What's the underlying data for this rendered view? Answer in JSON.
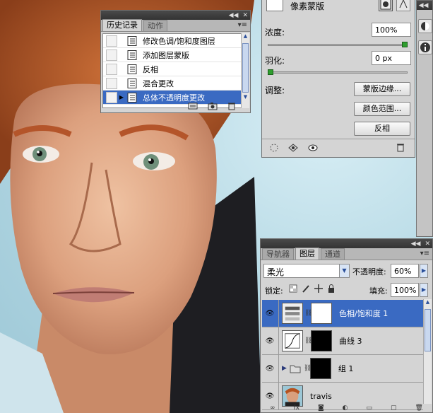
{
  "history": {
    "tabs": [
      "历史记录",
      "动作"
    ],
    "items": [
      {
        "label": "修改色调/饱和度图层",
        "selected": false
      },
      {
        "label": "添加图层蒙版",
        "selected": false
      },
      {
        "label": "反相",
        "selected": false
      },
      {
        "label": "混合更改",
        "selected": false
      },
      {
        "label": "总体不透明度更改",
        "selected": true
      }
    ]
  },
  "masks": {
    "header_label": "像素蒙版",
    "density_label": "浓度:",
    "density_value": "100%",
    "density_level": 1.0,
    "feather_label": "羽化:",
    "feather_value": "0 px",
    "feather_level": 0.0,
    "adjust_label": "调整:",
    "buttons": {
      "mask_edge": "蒙版边缘...",
      "color_range": "颜色范围...",
      "invert": "反相"
    }
  },
  "layers": {
    "tabs": [
      "导航器",
      "图层",
      "通道"
    ],
    "blend_mode": "柔光",
    "opacity_label": "不透明度:",
    "opacity_value": "60%",
    "lock_label": "锁定:",
    "fill_label": "填充:",
    "fill_value": "100%",
    "items": [
      {
        "name": "色相/饱和度 1",
        "selected": true
      },
      {
        "name": "曲线 3",
        "selected": false
      },
      {
        "name": "组 1",
        "selected": false
      },
      {
        "name": "travis",
        "selected": false
      }
    ]
  },
  "colors": {
    "selection": "#3a6ac2",
    "panel_bg": "#d4d4d4",
    "slider_thumb": "#2e9e2e"
  }
}
